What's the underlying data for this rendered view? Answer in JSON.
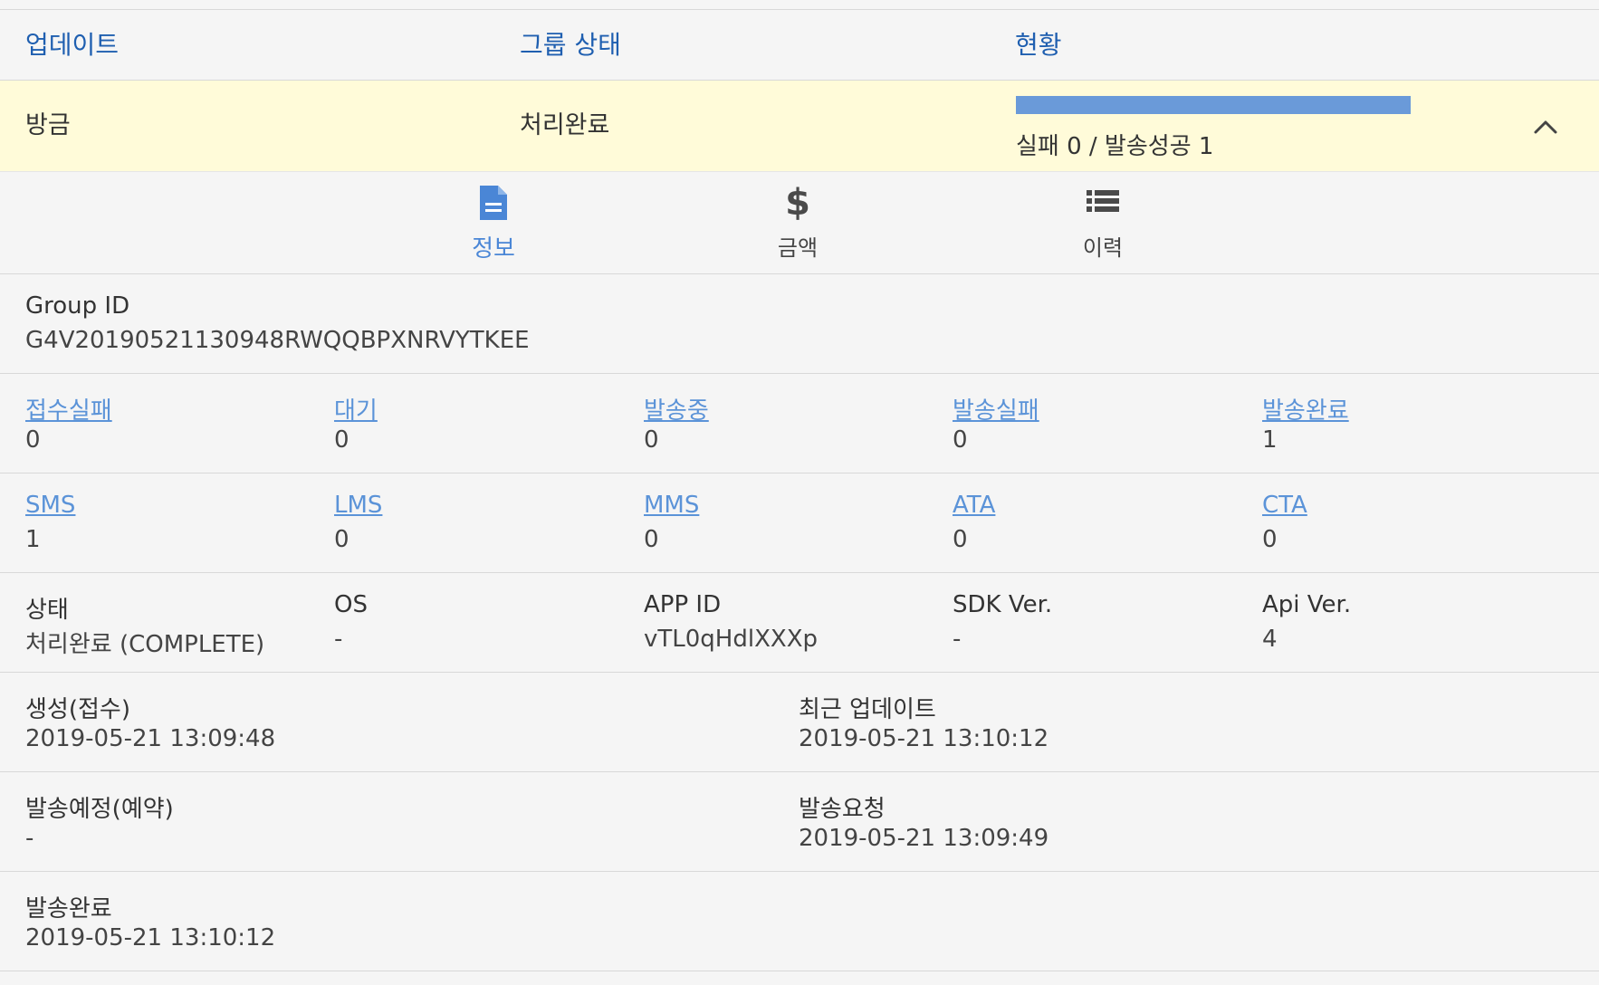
{
  "header": {
    "col_update": "업데이트",
    "col_group_status": "그룹 상태",
    "col_status": "현황"
  },
  "summary": {
    "updated": "방금",
    "group_status": "처리완료",
    "progress_fraction": 1.0,
    "progress_text": "실패 0 / 발송성공 1",
    "collapse_icon": "chevron-up-icon"
  },
  "tabs": [
    {
      "label": "정보",
      "icon": "document-icon",
      "active": true
    },
    {
      "label": "금액",
      "icon": "dollar-icon",
      "active": false
    },
    {
      "label": "이력",
      "icon": "list-icon",
      "active": false
    }
  ],
  "group": {
    "label": "Group ID",
    "value": "G4V20190521130948RWQQBPXNRVYTKEE"
  },
  "counts": [
    {
      "label": "접수실패",
      "value": "0"
    },
    {
      "label": "대기",
      "value": "0"
    },
    {
      "label": "발송중",
      "value": "0"
    },
    {
      "label": "발송실패",
      "value": "0"
    },
    {
      "label": "발송완료",
      "value": "1"
    }
  ],
  "types": [
    {
      "label": "SMS",
      "value": "1"
    },
    {
      "label": "LMS",
      "value": "0"
    },
    {
      "label": "MMS",
      "value": "0"
    },
    {
      "label": "ATA",
      "value": "0"
    },
    {
      "label": "CTA",
      "value": "0"
    }
  ],
  "meta": [
    {
      "label": "상태",
      "value": "처리완료 (COMPLETE)"
    },
    {
      "label": "OS",
      "value": "-"
    },
    {
      "label": "APP ID",
      "value": "vTL0qHdlXXXp"
    },
    {
      "label": "SDK Ver.",
      "value": "-"
    },
    {
      "label": "Api Ver.",
      "value": "4"
    }
  ],
  "times": {
    "created_label": "생성(접수)",
    "created_value": "2019-05-21 13:09:48",
    "last_update_label": "최근 업데이트",
    "last_update_value": "2019-05-21 13:10:12",
    "scheduled_label": "발송예정(예약)",
    "scheduled_value": "-",
    "requested_label": "발송요청",
    "requested_value": "2019-05-21 13:09:49",
    "completed_label": "발송완료",
    "completed_value": "2019-05-21 13:10:12"
  },
  "colors": {
    "header_text": "#1f5fb0",
    "summary_bg": "#fffbd9",
    "progress_fill": "#6a9ad9",
    "link": "#5b93d8",
    "active_tab": "#4a86d6"
  }
}
